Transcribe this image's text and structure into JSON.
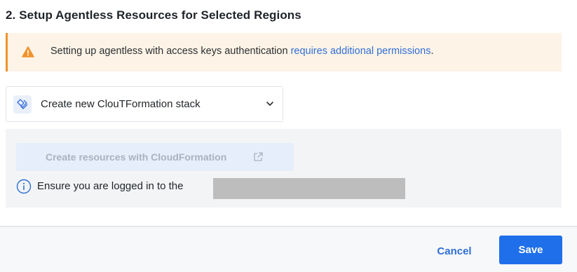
{
  "section": {
    "title": "2. Setup Agentless Resources for Selected Regions"
  },
  "warning": {
    "text": "Setting up agentless with access keys authentication ",
    "link_text": "requires additional permissions",
    "trailing": ".",
    "icon": "warning-triangle-icon",
    "accent_color": "#f0932b"
  },
  "stack_select": {
    "selected_value": "Create new ClouTFormation stack",
    "icon": "cloudformation-stack-icon"
  },
  "panel": {
    "cf_button_label": "Create resources with CloudFormation",
    "cf_button_icon": "external-link-icon",
    "info_text": "Ensure you are logged in to the",
    "info_icon": "info-circle-icon"
  },
  "footer": {
    "cancel_label": "Cancel",
    "save_label": "Save"
  },
  "colors": {
    "primary": "#1f6feb",
    "link": "#2f6fd6",
    "warning_bg": "#fdf3e6"
  }
}
